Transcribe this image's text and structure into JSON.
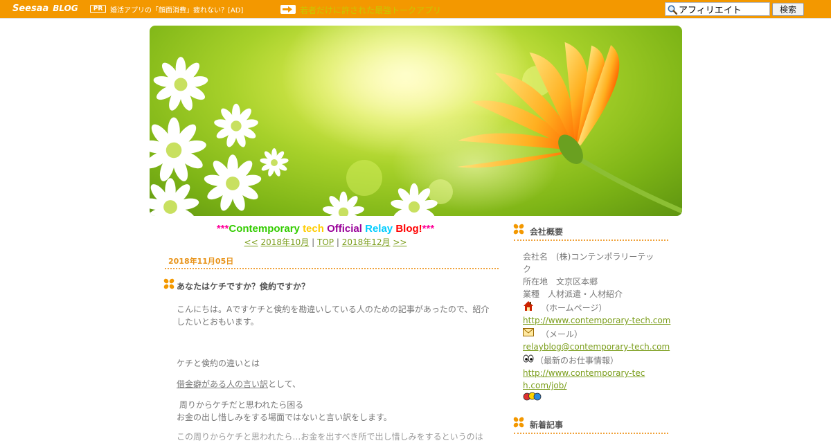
{
  "topbar": {
    "brand_name": "Seesaa",
    "brand_blog": "BLOG",
    "pr_badge": "PR",
    "pr_text": "婚活アプリの「顔面消費」疲れない？[AD]",
    "promo_text": "若者だけに許された最強トークアプリ",
    "search_value": "アフィリエイト",
    "search_button": "検索"
  },
  "blog": {
    "title_stars_left": "***",
    "title_words": [
      "Contemporary",
      "tech",
      "Official",
      "Relay",
      "Blog!"
    ],
    "title_stars_right": "***",
    "nav_prev": "<<",
    "nav_prev_month": "2018年10月",
    "nav_sep1": "|",
    "nav_top": "TOP",
    "nav_sep2": "|",
    "nav_next_month": "2018年12月",
    "nav_next": ">>"
  },
  "entry": {
    "date": "2018年11月05日",
    "title": "あなたはケチですか？倹約ですか？",
    "para1": "こんにちは。Aですケチと倹約を勘違いしている人のための記事があったので、紹介したいとおもいます。",
    "para2": "ケチと倹約の違いとは",
    "para3_link": "借金癖がある人の言い訳",
    "para3_rest": "として、",
    "para4": " 周りからケチだと思われたら困る",
    "para5": "お金の出し惜しみをする場面ではないと言い訳をします。",
    "para6": "この周りからケチと思われたら…お金を出すべき所で出し惜しみをするというのは"
  },
  "sidebar": {
    "about_head": "会社概要",
    "company_name": "会社名　(株)コンテンポラリーテック",
    "address": "所在地　文京区本郷",
    "business": "業種　人材派遣・人材紹介",
    "home_label": "（ホームページ）",
    "home_url": "http://www.contemporary-tech.com",
    "mail_label": "（メール）",
    "mail_url": "relayblog@contemporary-tech.com",
    "jobs_label": "（最新のお仕事情報）",
    "jobs_url": "http://www.contemporary-tech.com/job/",
    "news_head": "新着記事"
  },
  "colors": {
    "topbar": "#f39800",
    "accent": "#e89319",
    "link": "#7a9d1a",
    "title_colors": [
      "#ff0099",
      "#33cc00",
      "#ffcc00",
      "#990099",
      "#00ccff",
      "#ff0000",
      "#ff0099"
    ]
  },
  "icons": [
    "search-icon",
    "arrow-right-icon",
    "clover-icon",
    "home-icon",
    "mail-icon",
    "eyes-icon",
    "people-icon"
  ]
}
